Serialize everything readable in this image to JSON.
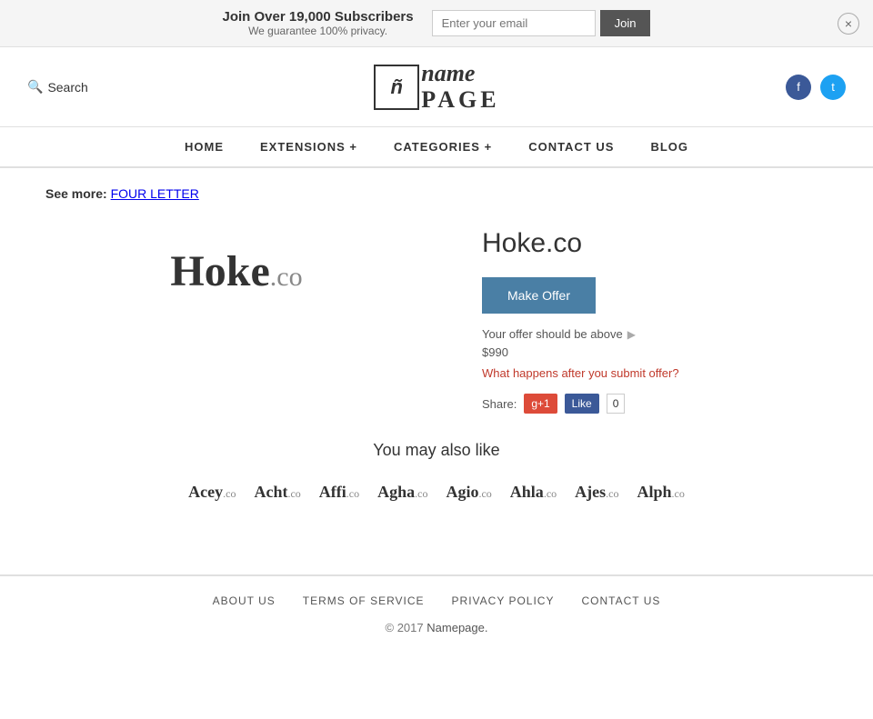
{
  "banner": {
    "main_text": "Join Over 19,000 Subscribers",
    "sub_text": "We guarantee 100% privacy.",
    "email_placeholder": "Enter your email",
    "join_button": "Join",
    "close_button": "×"
  },
  "header": {
    "search_label": "Search",
    "logo_icon": "ñ",
    "logo_name": "name",
    "logo_page": "PAGE",
    "facebook_title": "f",
    "twitter_title": "t"
  },
  "nav": {
    "items": [
      {
        "label": "HOME",
        "id": "home"
      },
      {
        "label": "EXTENSIONS +",
        "id": "extensions"
      },
      {
        "label": "CATEGORIES +",
        "id": "categories"
      },
      {
        "label": "CONTACT US",
        "id": "contact"
      },
      {
        "label": "BLOG",
        "id": "blog"
      }
    ]
  },
  "see_more": {
    "prefix": "See more:",
    "link_text": "FOUR LETTER"
  },
  "domain": {
    "name": "Hoke",
    "tld": ".co",
    "full_name": "Hoke.co",
    "make_offer_label": "Make Offer",
    "offer_above_text": "Your offer should be above",
    "offer_price": "$990",
    "offer_question": "What happens after you submit offer?",
    "share_label": "Share:",
    "gplus_label": "g+1",
    "fb_like_label": "Like",
    "fb_count": "0"
  },
  "similar": {
    "heading": "You may also like",
    "items": [
      {
        "name": "Acey",
        "tld": ".co"
      },
      {
        "name": "Acht",
        "tld": ".co"
      },
      {
        "name": "Affi",
        "tld": ".co"
      },
      {
        "name": "Agha",
        "tld": ".co"
      },
      {
        "name": "Agio",
        "tld": ".co"
      },
      {
        "name": "Ahla",
        "tld": ".co"
      },
      {
        "name": "Ajes",
        "tld": ".co"
      },
      {
        "name": "Alph",
        "tld": ".co"
      }
    ]
  },
  "footer": {
    "links": [
      {
        "label": "ABOUT US",
        "id": "about"
      },
      {
        "label": "TERMS OF SERVICE",
        "id": "terms"
      },
      {
        "label": "PRIVACY POLICY",
        "id": "privacy"
      },
      {
        "label": "CONTACT US",
        "id": "contact"
      }
    ],
    "copyright_prefix": "© 2017",
    "copyright_brand": "Namepage.",
    "copyright_suffix": ""
  }
}
